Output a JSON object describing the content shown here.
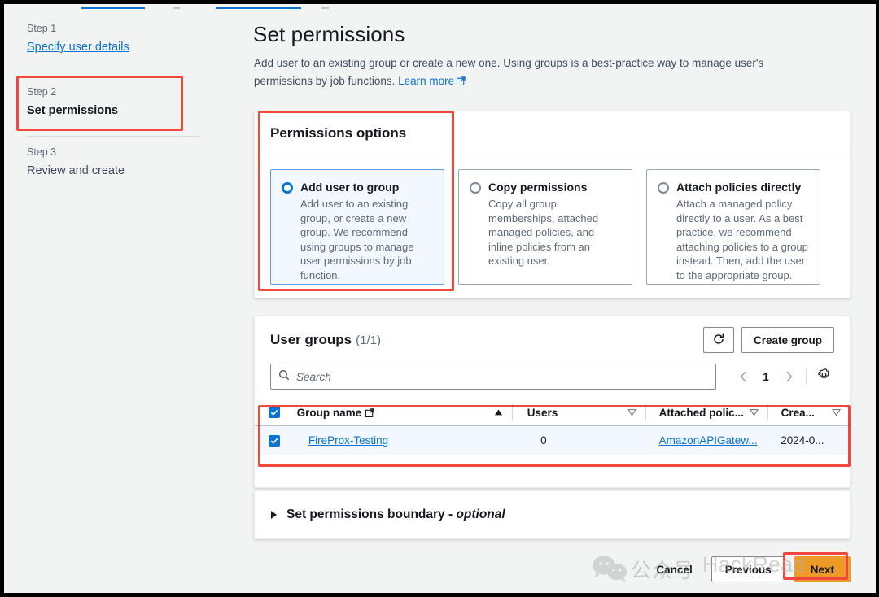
{
  "breadcrumb": {
    "stub_note": ""
  },
  "wizard": {
    "steps": [
      {
        "number": "Step 1",
        "label": "Specify user details",
        "state": "link"
      },
      {
        "number": "Step 2",
        "label": "Set permissions",
        "state": "current"
      },
      {
        "number": "Step 3",
        "label": "Review and create",
        "state": "plain"
      }
    ]
  },
  "page": {
    "title": "Set permissions",
    "description_1": "Add user to an existing group or create a new one. Using groups is a best-practice way to manage user's",
    "description_2": "permissions by job functions.",
    "learn_more": "Learn more"
  },
  "permissions_options": {
    "heading": "Permissions options",
    "tiles": [
      {
        "title": "Add user to group",
        "description": "Add user to an existing group, or create a new group. We recommend using groups to manage user permissions by job function.",
        "selected": true
      },
      {
        "title": "Copy permissions",
        "description": "Copy all group memberships, attached managed policies, and inline policies from an existing user.",
        "selected": false
      },
      {
        "title": "Attach policies directly",
        "description": "Attach a managed policy directly to a user. As a best practice, we recommend attaching policies to a group instead. Then, add the user to the appropriate group.",
        "selected": false
      }
    ]
  },
  "user_groups": {
    "title": "User groups",
    "count": "(1/1)",
    "refresh_label": "refresh-icon",
    "create_group_label": "Create group",
    "search": {
      "placeholder": "Search",
      "value": ""
    },
    "pagination": {
      "prev": "‹",
      "page": "1",
      "next": "›"
    },
    "settings_label": "gear-icon",
    "table": {
      "select_all_checked": true,
      "columns": [
        {
          "label": "Group name",
          "sort": "asc",
          "external_link": true
        },
        {
          "label": "Users",
          "sort": "none",
          "external_link": false
        },
        {
          "label": "Attached polic...",
          "sort": "none",
          "external_link": false
        },
        {
          "label": "Crea...",
          "sort": "none",
          "external_link": false
        }
      ],
      "rows": [
        {
          "checked": true,
          "group_name": "FireProx-Testing",
          "users": "0",
          "attached_policies": "AmazonAPIGatew...",
          "created": "2024-0..."
        }
      ]
    }
  },
  "permissions_boundary": {
    "label": "Set permissions boundary - ",
    "optional": "optional",
    "expanded": false
  },
  "footer": {
    "cancel": "Cancel",
    "previous": "Previous",
    "next": "Next"
  },
  "watermark": {
    "chinese": "公众号",
    "english": "HackRead"
  },
  "colors": {
    "accent_blue": "#0972d3",
    "selected_tile_bg": "#f2f8fd",
    "next_button": "#ec9c26",
    "annotation_red": "#f0473f",
    "page_bg": "#f2f3f3"
  }
}
